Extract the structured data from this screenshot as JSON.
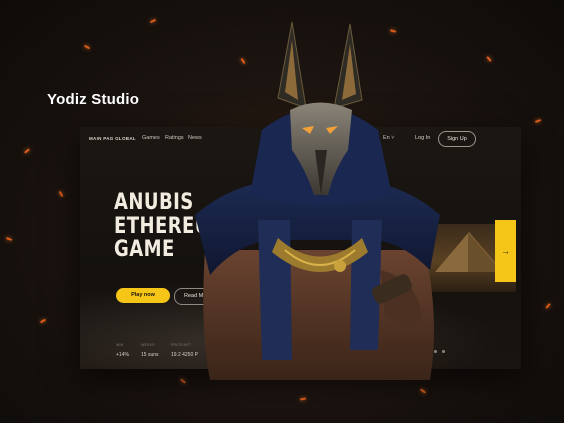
{
  "studio": {
    "name": "Yodiz Studio"
  },
  "nav": {
    "brand": "MAIN PAG GLOBAL",
    "links": [
      "Games",
      "Ratings",
      "News"
    ],
    "language": "En",
    "login": "Log In",
    "signup": "Sign Up"
  },
  "hero": {
    "title_lines": [
      "ANUBIS",
      "ETHEREUM",
      "GAME"
    ],
    "play_label": "Play now",
    "read_label": "Read M"
  },
  "stats": [
    {
      "label": "WIN",
      "value": "+14%"
    },
    {
      "label": "WEEKS",
      "value": "15 suns"
    },
    {
      "label": "PRICE/NFT",
      "value": "19.2 4250 P"
    }
  ],
  "slider": {
    "arrow": "→"
  },
  "colors": {
    "accent": "#f5c518",
    "background": "#14110e",
    "ember": "#ff6a1a"
  }
}
